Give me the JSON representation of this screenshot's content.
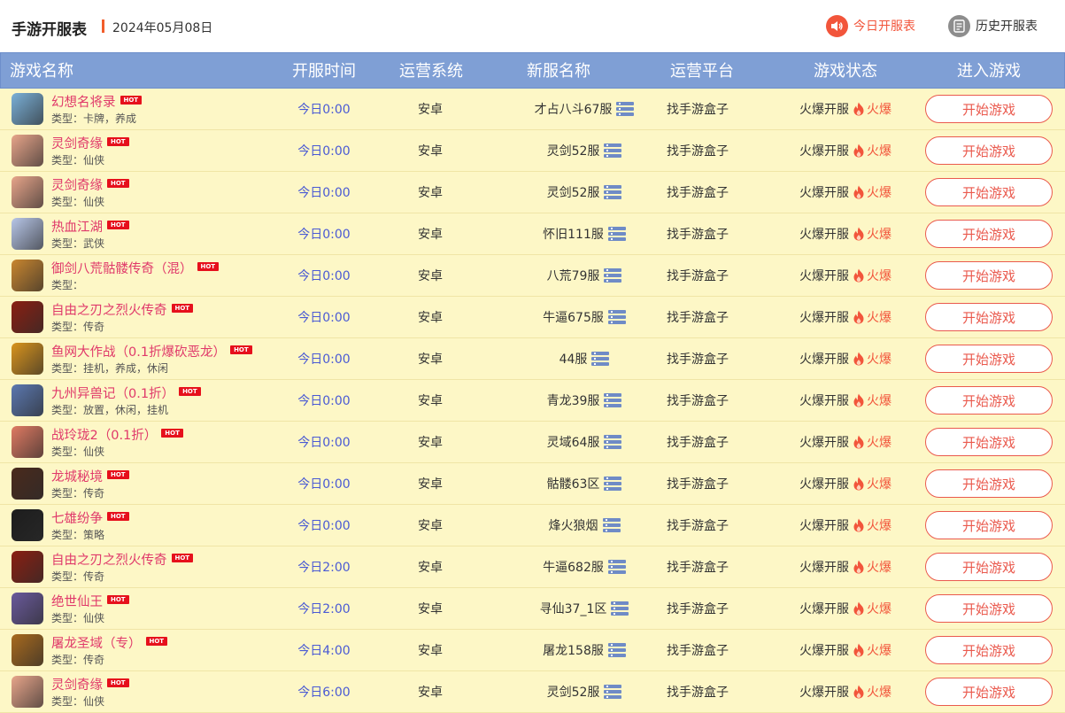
{
  "header": {
    "title": "手游开服表",
    "date": "2024年05月08日",
    "tab_today": "今日开服表",
    "tab_history": "历史开服表"
  },
  "table": {
    "columns": [
      "游戏名称",
      "开服时间",
      "运营系统",
      "新服名称",
      "运营平台",
      "游戏状态",
      "进入游戏"
    ],
    "type_prefix": "类型：",
    "hot_badge": "HOT",
    "rows": [
      {
        "name": "幻想名将录",
        "type": "卡牌，养成",
        "time": "今日0:00",
        "system": "安卓",
        "server": "才占八斗67服",
        "platform": "找手游盒子",
        "status": "火爆开服",
        "heat": "火爆",
        "action": "开始游戏",
        "icon_color": "#7ab0d8"
      },
      {
        "name": "灵剑奇缘",
        "type": "仙侠",
        "time": "今日0:00",
        "system": "安卓",
        "server": "灵剑52服",
        "platform": "找手游盒子",
        "status": "火爆开服",
        "heat": "火爆",
        "action": "开始游戏",
        "icon_color": "#e8a58a"
      },
      {
        "name": "灵剑奇缘",
        "type": "仙侠",
        "time": "今日0:00",
        "system": "安卓",
        "server": "灵剑52服",
        "platform": "找手游盒子",
        "status": "火爆开服",
        "heat": "火爆",
        "action": "开始游戏",
        "icon_color": "#e8a58a"
      },
      {
        "name": "热血江湖",
        "type": "武侠",
        "time": "今日0:00",
        "system": "安卓",
        "server": "怀旧111服",
        "platform": "找手游盒子",
        "status": "火爆开服",
        "heat": "火爆",
        "action": "开始游戏",
        "icon_color": "#b7c6e8"
      },
      {
        "name": "御剑八荒骷髅传奇（混）",
        "type": "",
        "time": "今日0:00",
        "system": "安卓",
        "server": "八荒79服",
        "platform": "找手游盒子",
        "status": "火爆开服",
        "heat": "火爆",
        "action": "开始游戏",
        "icon_color": "#c9862f"
      },
      {
        "name": "自由之刃之烈火传奇",
        "type": "传奇",
        "time": "今日0:00",
        "system": "安卓",
        "server": "牛逼675服",
        "platform": "找手游盒子",
        "status": "火爆开服",
        "heat": "火爆",
        "action": "开始游戏",
        "icon_color": "#8a1f12"
      },
      {
        "name": "鱼网大作战（0.1折爆砍恶龙）",
        "type": "挂机，养成，休闲",
        "time": "今日0:00",
        "system": "安卓",
        "server": "44服",
        "platform": "找手游盒子",
        "status": "火爆开服",
        "heat": "火爆",
        "action": "开始游戏",
        "icon_color": "#d9941d"
      },
      {
        "name": "九州异兽记（0.1折）",
        "type": "放置，休闲，挂机",
        "time": "今日0:00",
        "system": "安卓",
        "server": "青龙39服",
        "platform": "找手游盒子",
        "status": "火爆开服",
        "heat": "火爆",
        "action": "开始游戏",
        "icon_color": "#5b78b0"
      },
      {
        "name": "战玲珑2（0.1折）",
        "type": "仙侠",
        "time": "今日0:00",
        "system": "安卓",
        "server": "灵域64服",
        "platform": "找手游盒子",
        "status": "火爆开服",
        "heat": "火爆",
        "action": "开始游戏",
        "icon_color": "#e07a62"
      },
      {
        "name": "龙城秘境",
        "type": "传奇",
        "time": "今日0:00",
        "system": "安卓",
        "server": "骷髅63区",
        "platform": "找手游盒子",
        "status": "火爆开服",
        "heat": "火爆",
        "action": "开始游戏",
        "icon_color": "#4a2a1c"
      },
      {
        "name": "七雄纷争",
        "type": "策略",
        "time": "今日0:00",
        "system": "安卓",
        "server": "烽火狼烟",
        "platform": "找手游盒子",
        "status": "火爆开服",
        "heat": "火爆",
        "action": "开始游戏",
        "icon_color": "#1d1d1d"
      },
      {
        "name": "自由之刃之烈火传奇",
        "type": "传奇",
        "time": "今日2:00",
        "system": "安卓",
        "server": "牛逼682服",
        "platform": "找手游盒子",
        "status": "火爆开服",
        "heat": "火爆",
        "action": "开始游戏",
        "icon_color": "#8a1f12"
      },
      {
        "name": "绝世仙王",
        "type": "仙侠",
        "time": "今日2:00",
        "system": "安卓",
        "server": "寻仙37_1区",
        "platform": "找手游盒子",
        "status": "火爆开服",
        "heat": "火爆",
        "action": "开始游戏",
        "icon_color": "#6a5a9c"
      },
      {
        "name": "屠龙圣域（专）",
        "type": "传奇",
        "time": "今日4:00",
        "system": "安卓",
        "server": "屠龙158服",
        "platform": "找手游盒子",
        "status": "火爆开服",
        "heat": "火爆",
        "action": "开始游戏",
        "icon_color": "#a86a1e"
      },
      {
        "name": "灵剑奇缘",
        "type": "仙侠",
        "time": "今日6:00",
        "system": "安卓",
        "server": "灵剑52服",
        "platform": "找手游盒子",
        "status": "火爆开服",
        "heat": "火爆",
        "action": "开始游戏",
        "icon_color": "#e8a58a"
      }
    ]
  }
}
